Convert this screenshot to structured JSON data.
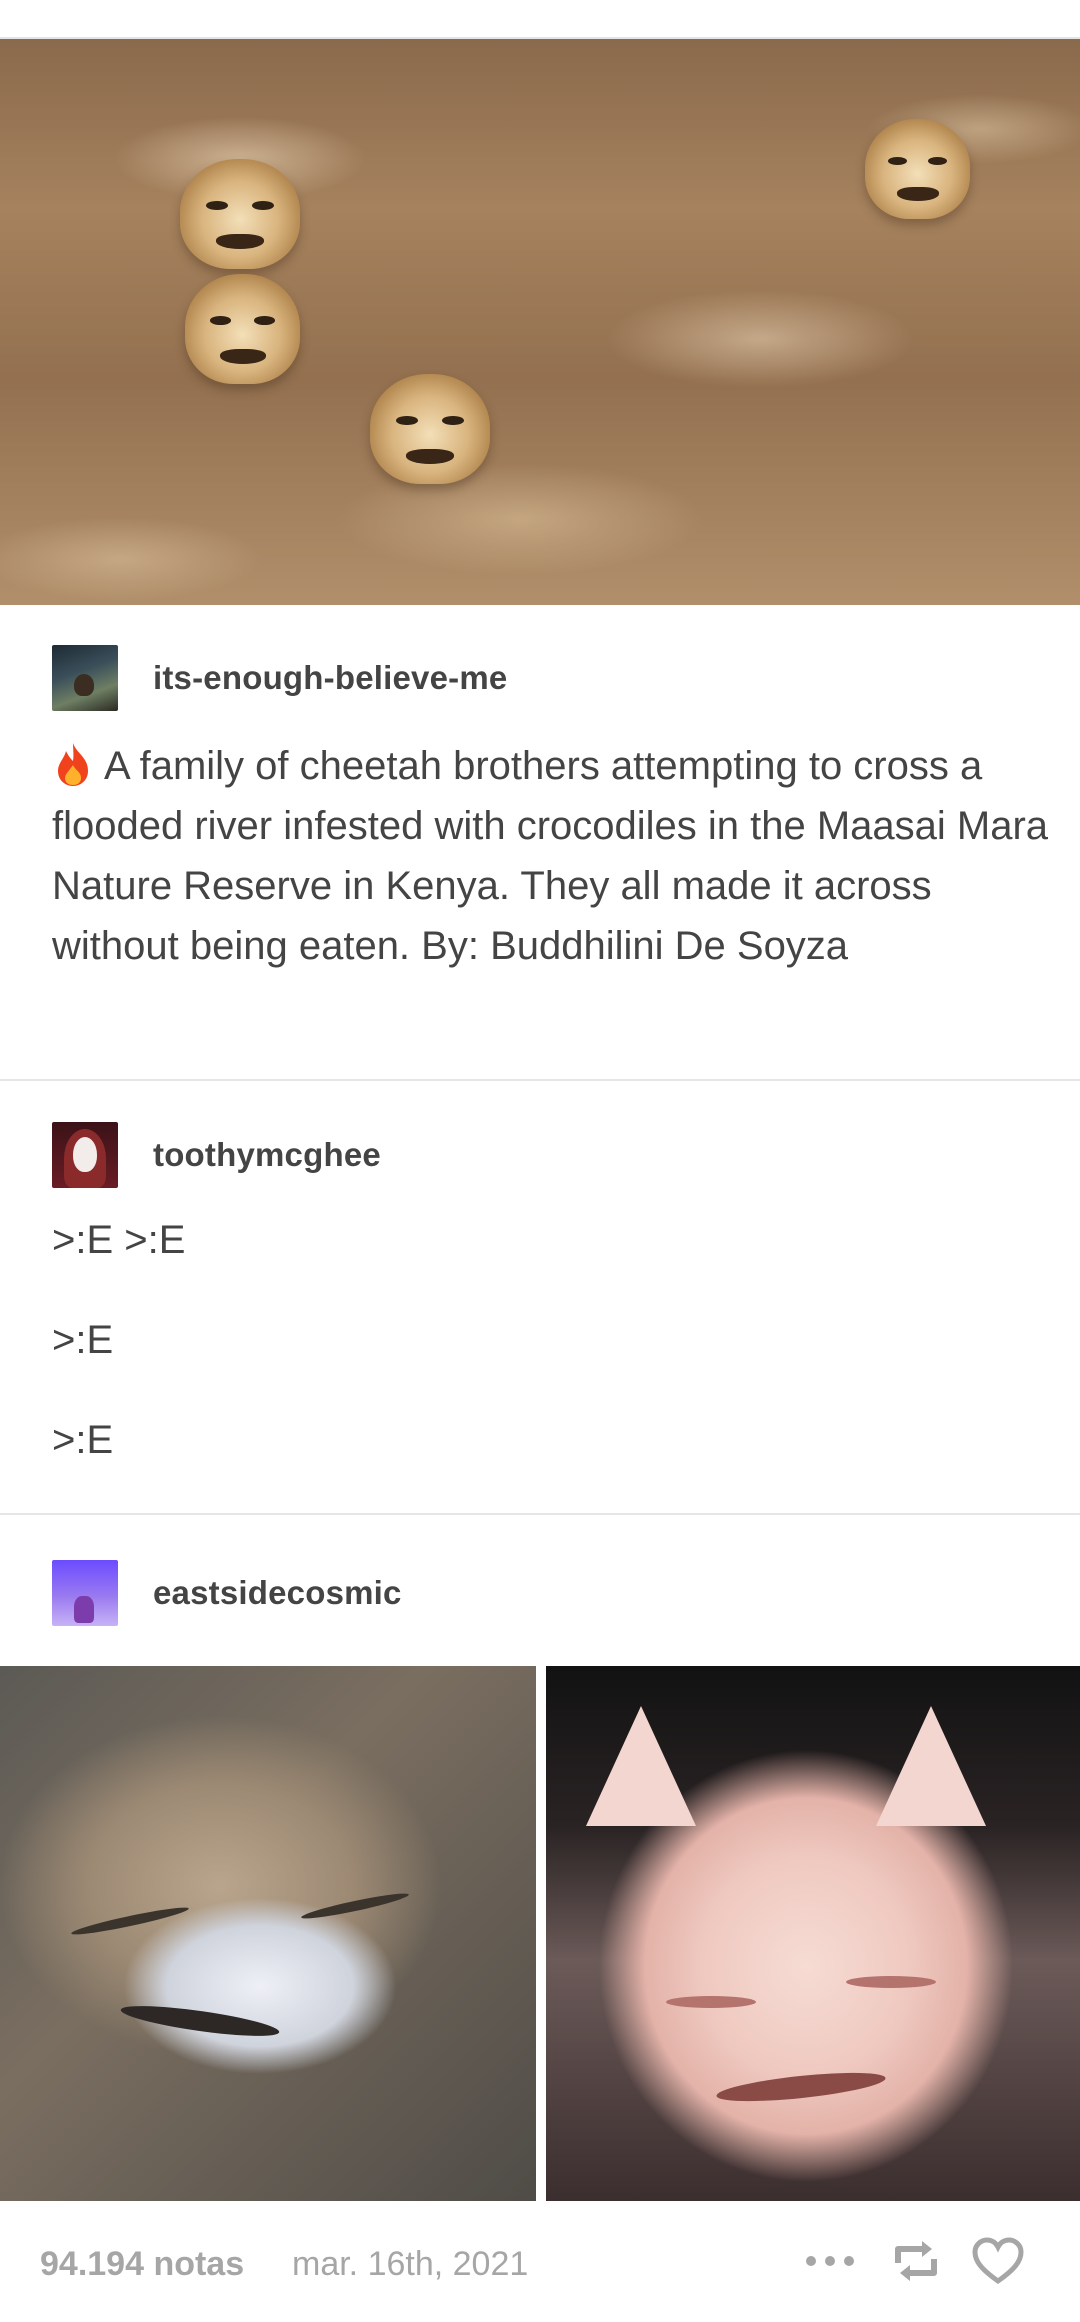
{
  "posts": [
    {
      "username": "its-enough-believe-me",
      "icon": "fire-icon",
      "text": "A family of cheetah brothers attempting to cross a flooded river infested with crocodiles in the Maasai Mara Nature Reserve in Kenya. They all made it across without being eaten. By: Buddhilini De Soyza"
    },
    {
      "username": "toothymcghee",
      "lines": [
        ">:E >:E",
        ">:E",
        ">:E"
      ]
    },
    {
      "username": "eastsidecosmic"
    }
  ],
  "footer": {
    "notes": "94.194 notas",
    "date": "mar. 16th, 2021",
    "icons": [
      "more-dots-icon",
      "reblog-icon",
      "heart-icon"
    ]
  },
  "colors": {
    "text": "#444444",
    "muted": "#a6a6a6",
    "divider": "#e6e6e6"
  }
}
